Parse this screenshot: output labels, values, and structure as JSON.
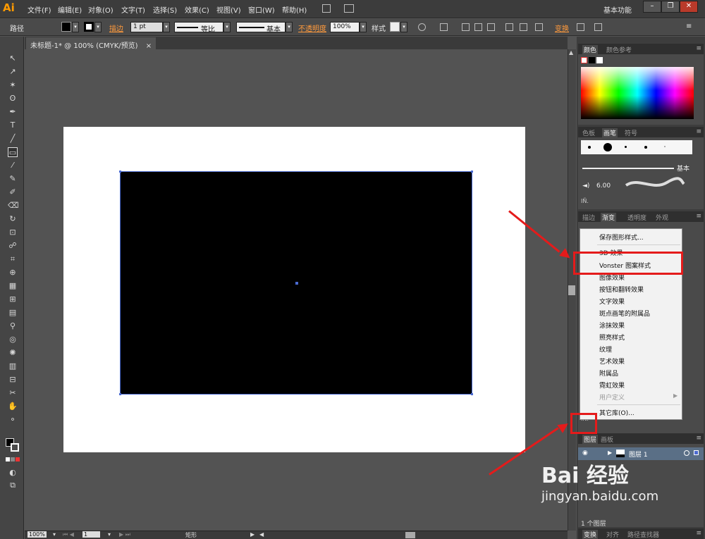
{
  "app": {
    "logo": "Ai",
    "workspace": "基本功能"
  },
  "menu": [
    "文件(F)",
    "编辑(E)",
    "对象(O)",
    "文字(T)",
    "选择(S)",
    "效果(C)",
    "视图(V)",
    "窗口(W)",
    "帮助(H)"
  ],
  "window_buttons": {
    "minimize": "–",
    "restore": "❐",
    "close": "✕"
  },
  "control_bar": {
    "object_type": "路径",
    "stroke_label": "描边",
    "stroke_weight": "1 pt",
    "profile_label": "等比",
    "brush_label": "基本",
    "opacity_label": "不透明度",
    "opacity_value": "100%",
    "style_label": "样式",
    "transform_label": "变换"
  },
  "document": {
    "tab_title": "未标题-1* @ 100% (CMYK/预览)",
    "tab_close": "×"
  },
  "status": {
    "zoom": "100%",
    "artboard": "1",
    "tool_name": "矩形"
  },
  "panels": {
    "color_tabs": [
      "颜色",
      "颜色参考"
    ],
    "brush_tabs": [
      "色板",
      "画笔",
      "符号"
    ],
    "brush_stroke_label": "基本",
    "brush_size": "6.00",
    "gradient_tabs": [
      "描边",
      "渐变",
      "透明度",
      "外观"
    ],
    "layers_tabs": [
      "图层",
      "画板"
    ],
    "layer_name": "图层 1",
    "layers_count": "1 个图层",
    "bottom_tabs": [
      "变换",
      "对齐",
      "路径查找器"
    ]
  },
  "flyout_menu": {
    "items": [
      {
        "label": "保存图形样式...",
        "disabled": false
      },
      {
        "label": "3D 效果",
        "disabled": false
      },
      {
        "label": "Vonster 图案样式",
        "disabled": false
      },
      {
        "label": "图像效果",
        "disabled": false
      },
      {
        "label": "按钮和翻转效果",
        "disabled": false
      },
      {
        "label": "文字效果",
        "disabled": false
      },
      {
        "label": "斑点画笔的附属品",
        "disabled": false
      },
      {
        "label": "涂抹效果",
        "disabled": false
      },
      {
        "label": "照亮样式",
        "disabled": false
      },
      {
        "label": "纹理",
        "disabled": false
      },
      {
        "label": "艺术效果",
        "disabled": false
      },
      {
        "label": "附属品",
        "disabled": false
      },
      {
        "label": "霓虹效果",
        "disabled": false
      },
      {
        "label": "用户定义",
        "disabled": true
      },
      {
        "label": "其它库(O)...",
        "disabled": false
      }
    ]
  },
  "watermark": {
    "brand": "Bai 经验",
    "url": "jingyan.baidu.com"
  },
  "colors": {
    "annotation_red": "#e41b1b",
    "selection_blue": "#4a6ad0",
    "ai_orange": "#ff9a00"
  }
}
